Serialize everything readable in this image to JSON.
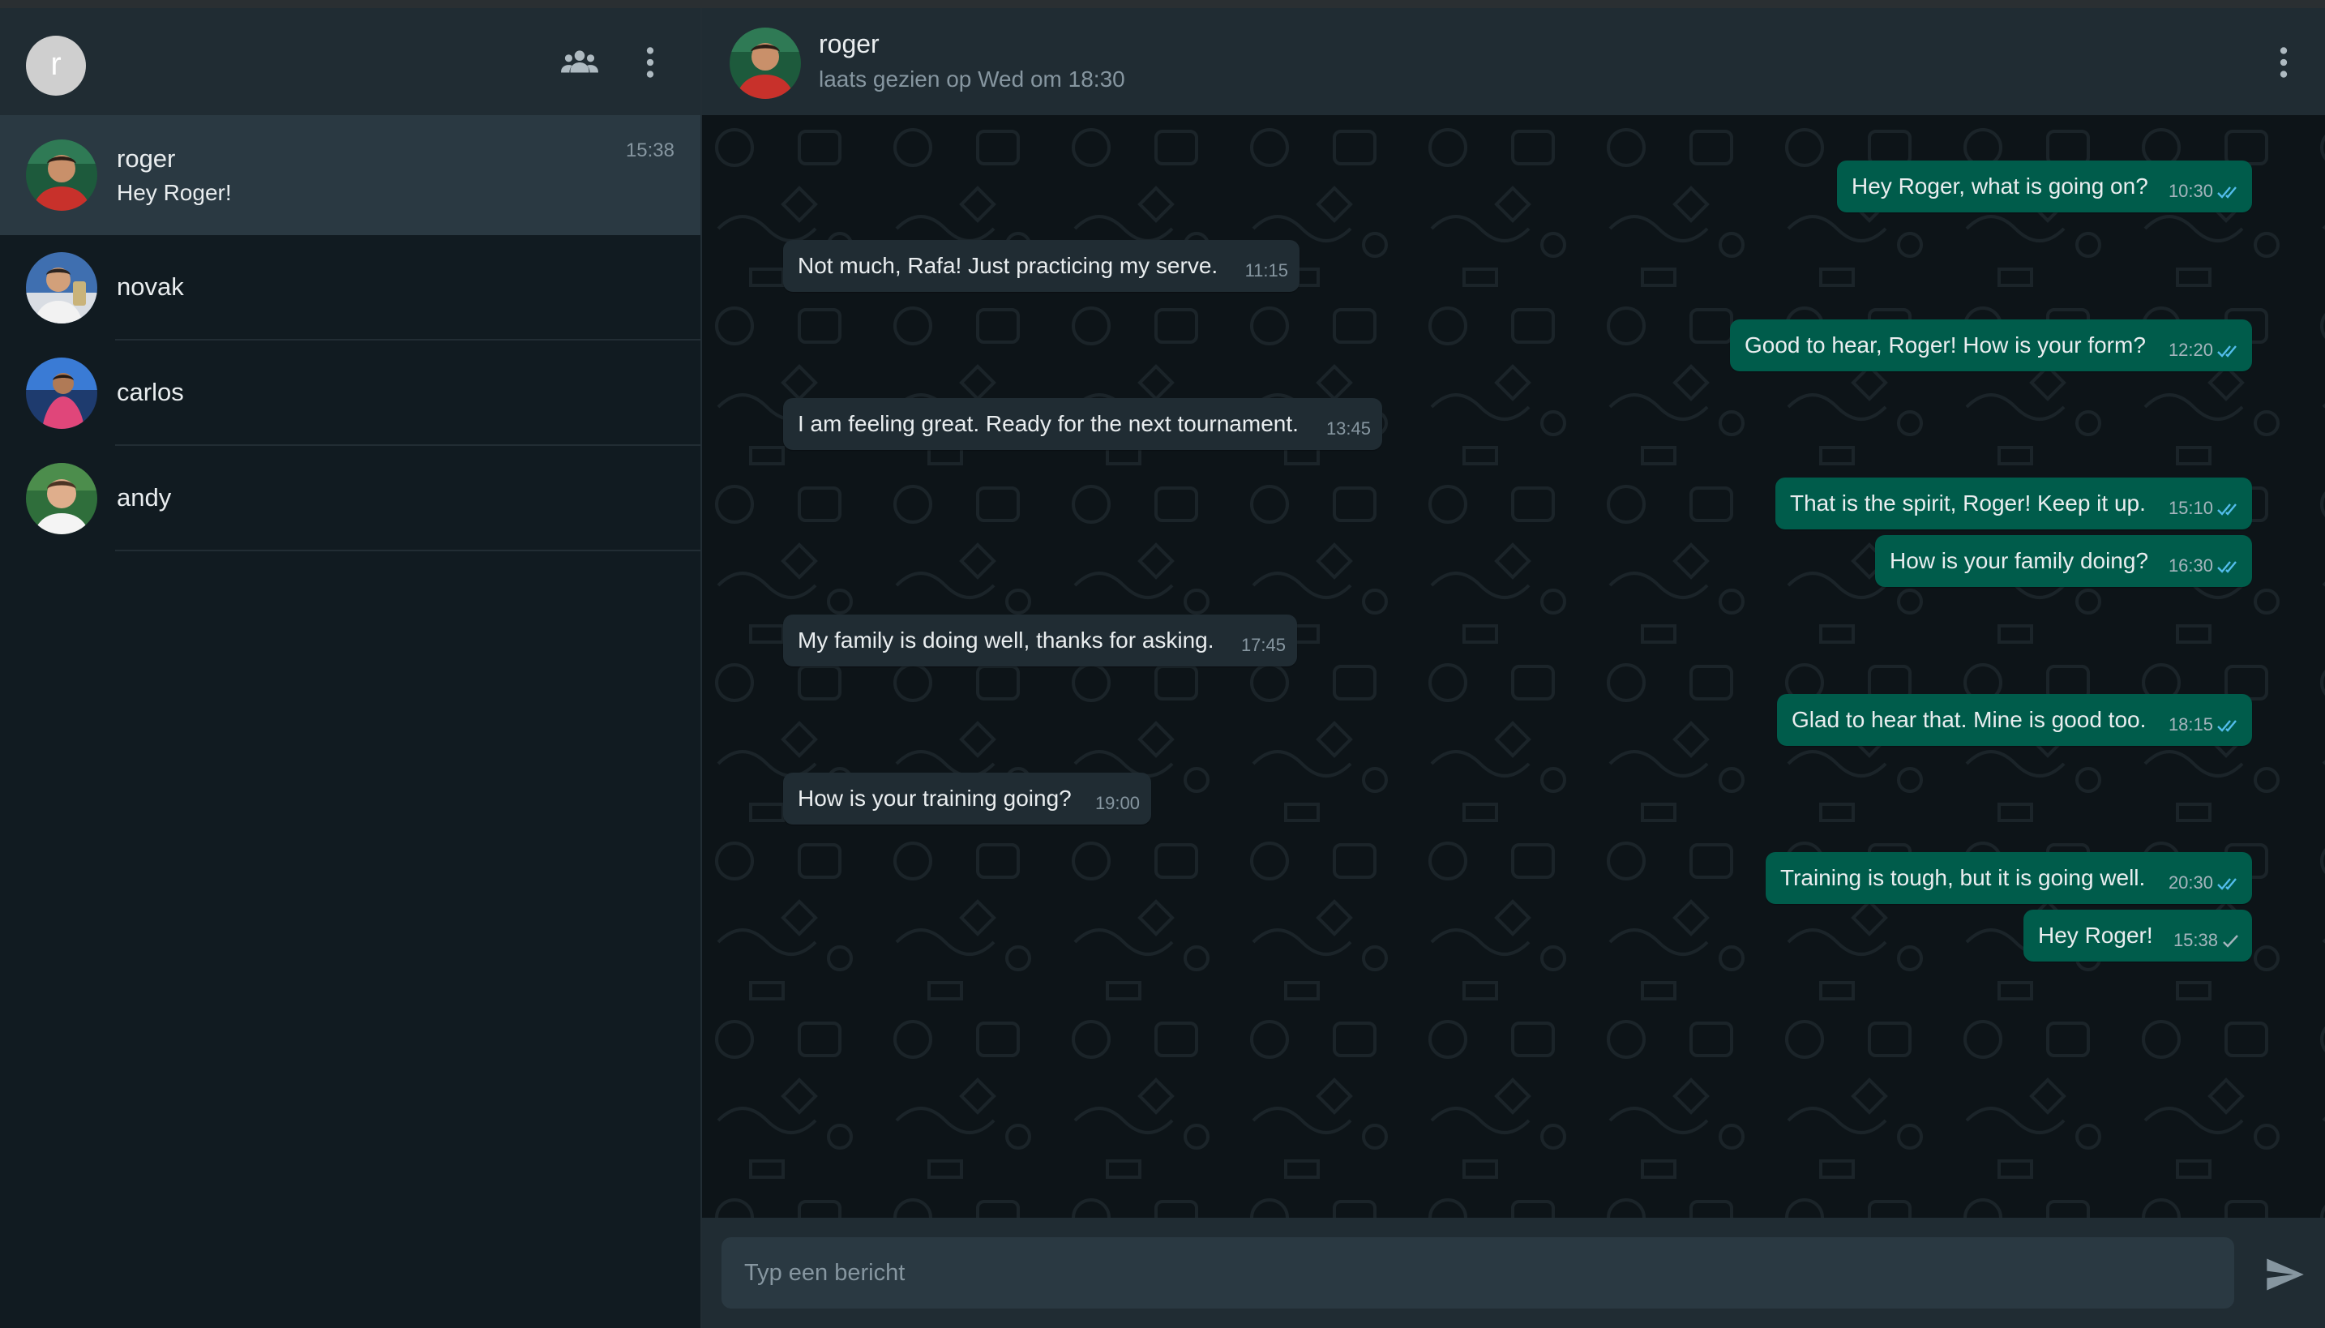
{
  "colors": {
    "accent": "#005c4b",
    "incoming_bubble": "#202c33",
    "panel": "#202c33",
    "background": "#0b141a",
    "tick_read": "#53bdeb"
  },
  "sidebar": {
    "me_initial": "r",
    "header_icons": [
      "community-icon",
      "menu-dots-icon"
    ],
    "chats": [
      {
        "name": "roger",
        "preview": "Hey Roger!",
        "time": "15:38",
        "active": true
      },
      {
        "name": "novak",
        "preview": "",
        "time": ""
      },
      {
        "name": "carlos",
        "preview": "",
        "time": ""
      },
      {
        "name": "andy",
        "preview": "",
        "time": ""
      }
    ]
  },
  "conversation": {
    "contact_name": "roger",
    "status": "laats gezien op Wed om 18:30",
    "messages": [
      {
        "dir": "out",
        "text": "Hey Roger, what is going on?",
        "time": "10:30",
        "ticks": "read"
      },
      {
        "dir": "in",
        "text": "Not much, Rafa! Just practicing my serve.",
        "time": "11:15"
      },
      {
        "dir": "out",
        "text": "Good to hear, Roger! How is your form?",
        "time": "12:20",
        "ticks": "read"
      },
      {
        "dir": "in",
        "text": "I am feeling great. Ready for the next tournament.",
        "time": "13:45"
      },
      {
        "dir": "out",
        "text": "That is the spirit, Roger! Keep it up.",
        "time": "15:10",
        "ticks": "read"
      },
      {
        "dir": "out",
        "text": "How is your family doing?",
        "time": "16:30",
        "ticks": "read"
      },
      {
        "dir": "in",
        "text": "My family is doing well, thanks for asking.",
        "time": "17:45"
      },
      {
        "dir": "out",
        "text": "Glad to hear that. Mine is good too.",
        "time": "18:15",
        "ticks": "read"
      },
      {
        "dir": "in",
        "text": "How is your training going?",
        "time": "19:00"
      },
      {
        "dir": "out",
        "text": "Training is tough, but it is going well.",
        "time": "20:30",
        "ticks": "read"
      },
      {
        "dir": "out",
        "text": "Hey Roger!",
        "time": "15:38",
        "ticks": "sent"
      }
    ]
  },
  "composer": {
    "placeholder": "Typ een bericht",
    "value": ""
  }
}
